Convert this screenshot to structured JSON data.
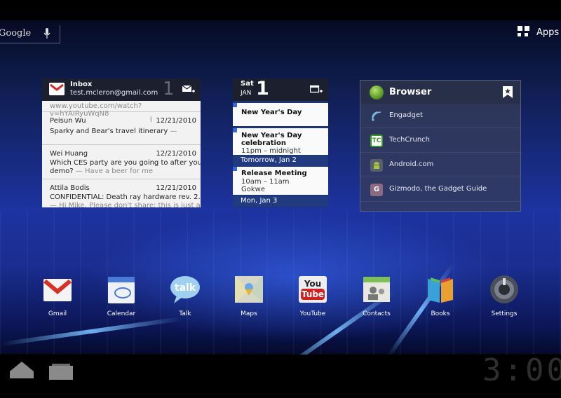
{
  "top_bar": {
    "search_label": "Google",
    "mic_icon": "microphone-icon",
    "apps_label": "Apps",
    "apps_icon": "apps-grid-icon"
  },
  "gmail_widget": {
    "folder": "Inbox",
    "account": "test.mcleron@gmail.com",
    "unread_count": "1",
    "partial_top_line": "www.youtube.com/watch?v=hYAIRyuWqN8",
    "messages": [
      {
        "from": "Peisun Wu",
        "date": "12/21/2010",
        "subject": "Sparky and Bear's travel itinerary",
        "snippet": " —",
        "has_attachment": true
      },
      {
        "from": "Wei Huang",
        "date": "12/21/2010",
        "subject": "Which CES party are you going to after your",
        "subject2": "demo?",
        "snippet": " — Have a beer for me"
      },
      {
        "from": "Attila Bodis",
        "date": "12/21/2010",
        "subject": "CONFIDENTIAL: Death ray hardware rev. 2.0",
        "snippet": "— Hi Mike, Please don't share; this is just a"
      }
    ]
  },
  "calendar_widget": {
    "day_of_week": "Sat",
    "month": "JAN",
    "day": "1",
    "events": [
      {
        "title": "New Year's Day"
      },
      {
        "title": "New Year's Day",
        "title2": "celebration",
        "time": "11pm – midnight"
      }
    ],
    "day_header_1": "Tomorrow, Jan 2",
    "events_day2": [
      {
        "title": "Release Meeting",
        "time": "10am – 11am",
        "location": "Gokwe"
      }
    ],
    "day_header_2": "Mon, Jan 3"
  },
  "browser_widget": {
    "title": "Browser",
    "bookmarks": [
      {
        "label": "Engadget",
        "icon": "engadget-icon",
        "color": "#3a3f52"
      },
      {
        "label": "TechCrunch",
        "icon": "techcrunch-icon",
        "color": "#2f7a2a"
      },
      {
        "label": "Android.com",
        "icon": "android-icon",
        "color": "#5a5f70"
      },
      {
        "label": "Gizmodo, the Gadget Guide",
        "icon": "gizmodo-icon",
        "color": "#7a5a70"
      }
    ]
  },
  "dock": [
    {
      "label": "Gmail",
      "icon": "gmail-icon"
    },
    {
      "label": "Calendar",
      "icon": "calendar-icon"
    },
    {
      "label": "Talk",
      "icon": "talk-icon"
    },
    {
      "label": "Maps",
      "icon": "maps-icon"
    },
    {
      "label": "YouTube",
      "icon": "youtube-icon"
    },
    {
      "label": "Contacts",
      "icon": "contacts-icon"
    },
    {
      "label": "Books",
      "icon": "books-icon"
    },
    {
      "label": "Settings",
      "icon": "settings-icon"
    }
  ],
  "youtube_icon_text": {
    "top": "You",
    "bottom": "Tube"
  },
  "talk_icon_text": "talk",
  "system_bar": {
    "clock": "3:00",
    "home_icon": "home-icon",
    "recent_icon": "recent-apps-icon"
  },
  "colors": {
    "accent_blue": "#3a66d8",
    "widget_header": "#1b1f2e",
    "calendar_dayband": "#223b80"
  }
}
